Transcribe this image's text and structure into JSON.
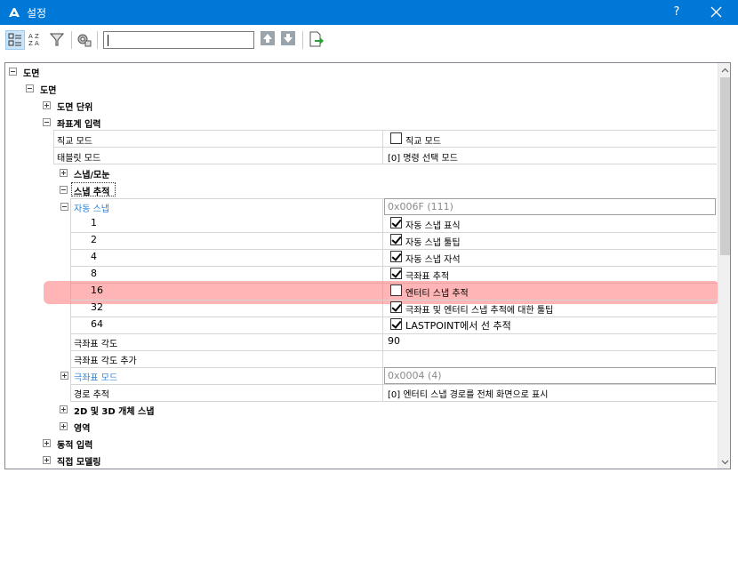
{
  "window": {
    "title": "설정",
    "help_label": "?",
    "accent_color": "#0078d7",
    "icons": {
      "app": "app-logo-icon",
      "close": "close-icon"
    }
  },
  "toolbar": {
    "search": {
      "value": "",
      "placeholder": ""
    },
    "icons": [
      "categorized-view-icon",
      "alphabetical-view-icon",
      "filter-icon",
      "settings-options-icon",
      "arrow-up-icon",
      "arrow-down-icon",
      "export-icon"
    ]
  },
  "tree": {
    "drawing_root": "도면",
    "drawing_child": "도면",
    "drawing_units": "도면 단위",
    "coord_input": "좌표계 입력",
    "ortho_mode_label": "직교 모드",
    "ortho_mode_value": "직교 모드",
    "tablet_mode_label": "태블릿 모드",
    "tablet_mode_value": "[0] 명령 선택 모드",
    "snap_grid": "스냅/모눈",
    "snap_tracking": "스냅 추적",
    "auto_snap_label": "자동 스냅",
    "auto_snap_value": "0x006F (111)",
    "snap_rows": [
      {
        "num": "1",
        "label": "자동 스냅 표식",
        "checked": true
      },
      {
        "num": "2",
        "label": "자동 스냅 툴팁",
        "checked": true
      },
      {
        "num": "4",
        "label": "자동 스냅 자석",
        "checked": true
      },
      {
        "num": "8",
        "label": "극좌표 추적",
        "checked": true
      },
      {
        "num": "16",
        "label": "엔터티 스냅 추적",
        "checked": false
      },
      {
        "num": "32",
        "label": "극좌표 및 엔터티 스냅 추적에 대한 툴팁",
        "checked": true
      },
      {
        "num": "64",
        "label": "LASTPOINT에서 선 추적",
        "checked": true
      }
    ],
    "polar_angle_label": "극좌표 각도",
    "polar_angle_value": "90",
    "polar_angle_add_label": "극좌표 각도 추가",
    "polar_angle_add_value": "",
    "polar_mode_label": "극좌표 모드",
    "polar_mode_value": "0x0004 (4)",
    "path_tracking_label": "경로 추적",
    "path_tracking_value": "[0] 엔터티 스냅 경로를 전체 화면으로 표시",
    "snap_2d3d": "2D 및 3D 개체 스냅",
    "region": "영역",
    "dynamic_input": "동적 입력",
    "direct_modeling": "직접 모델링"
  },
  "colors": {
    "link_blue": "#2f83d6",
    "highlight": "#ff7878"
  }
}
